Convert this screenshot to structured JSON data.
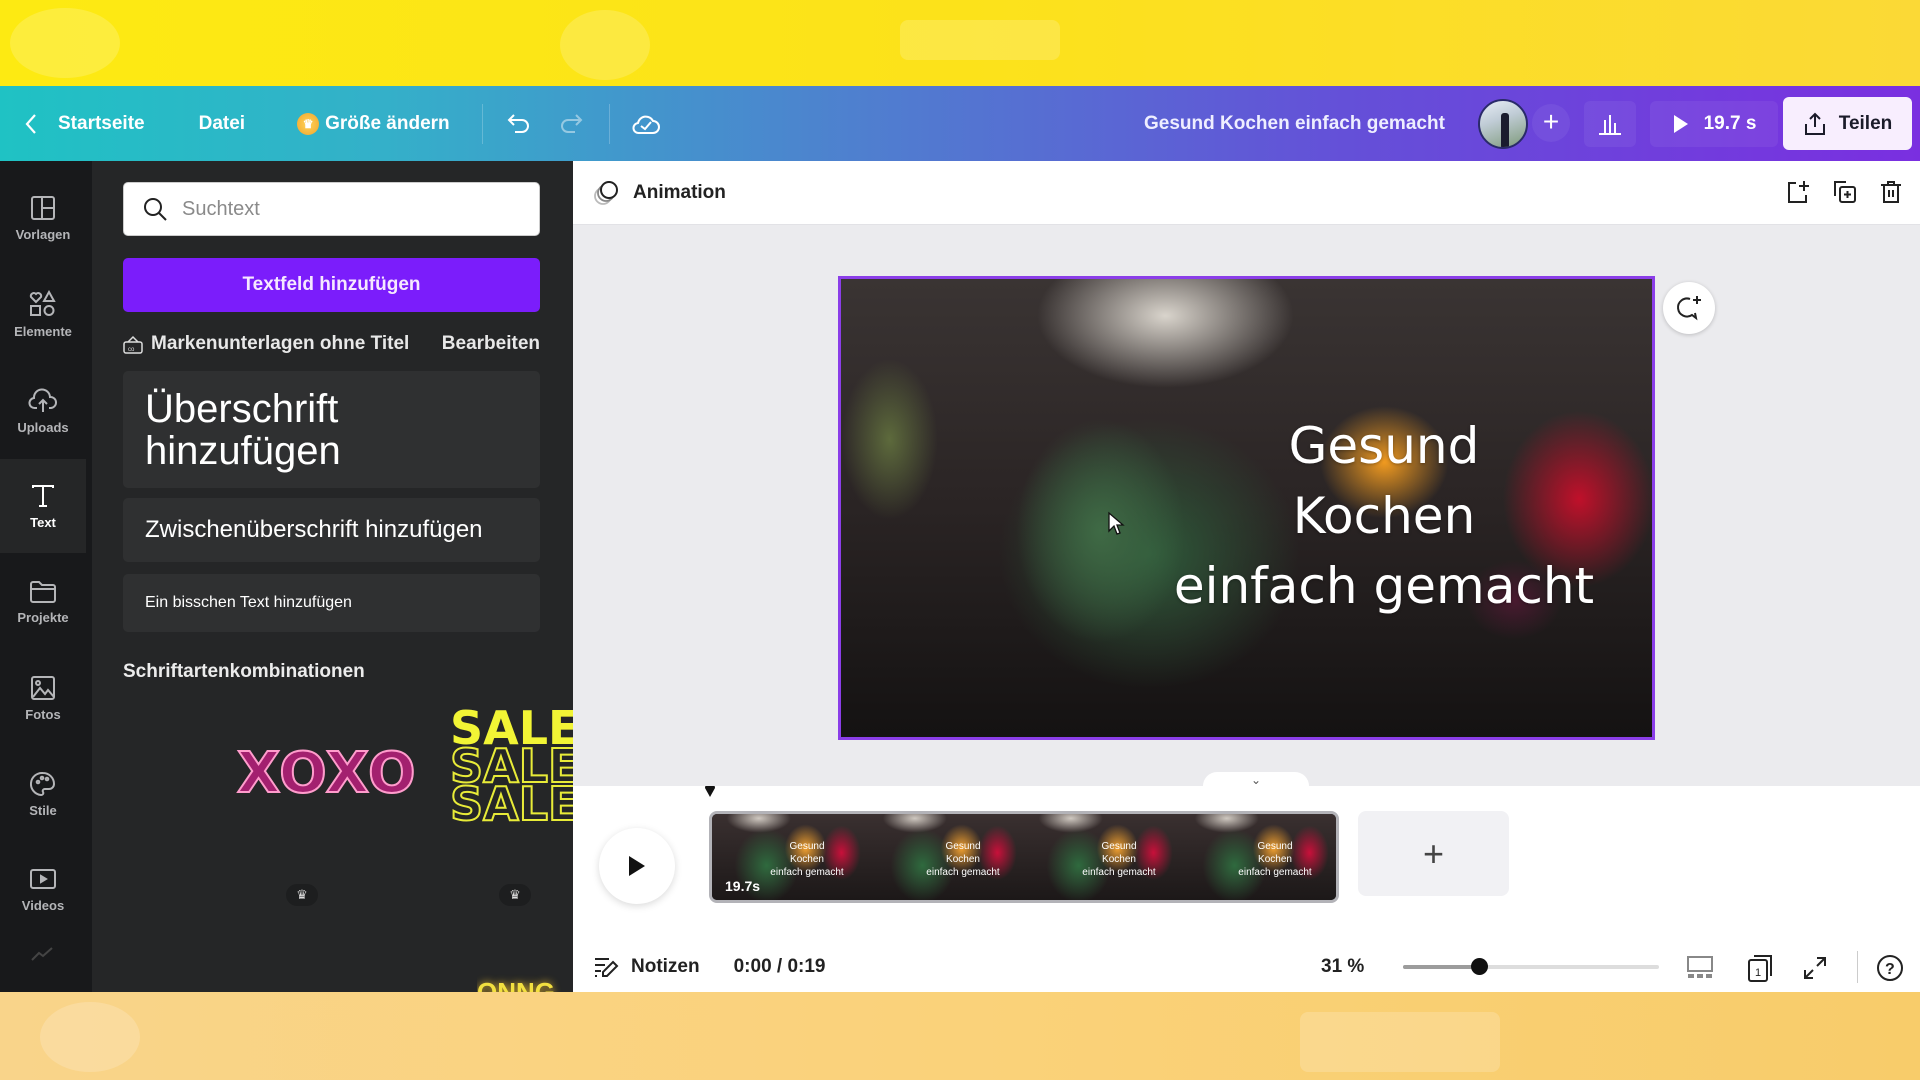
{
  "topbar": {
    "back_label": "Startseite",
    "file_label": "Datei",
    "resize_label": "Größe ändern",
    "document_title": "Gesund Kochen einfach gemacht",
    "play_duration": "19.7 s",
    "share_label": "Teilen"
  },
  "rail": {
    "items": [
      {
        "label": "Vorlagen",
        "icon": "templates-icon"
      },
      {
        "label": "Elemente",
        "icon": "elements-icon"
      },
      {
        "label": "Uploads",
        "icon": "upload-icon"
      },
      {
        "label": "Text",
        "icon": "text-icon",
        "active": true
      },
      {
        "label": "Projekte",
        "icon": "folder-icon"
      },
      {
        "label": "Fotos",
        "icon": "photo-icon"
      },
      {
        "label": "Stile",
        "icon": "palette-icon"
      },
      {
        "label": "Videos",
        "icon": "video-icon"
      }
    ]
  },
  "panel": {
    "search_placeholder": "Suchtext",
    "add_textbox_label": "Textfeld hinzufügen",
    "brand_kit_name": "Markenunterlagen ohne Titel",
    "brand_edit_label": "Bearbeiten",
    "heading_label": "Überschrift hinzufügen",
    "subheading_label": "Zwischenüberschrift hinzufügen",
    "body_label": "Ein bisschen Text hinzufügen",
    "combos_title": "Schriftartenkombinationen",
    "combos": [
      {
        "text": "XOXO",
        "premium": true
      },
      {
        "text": "SALE",
        "premium": true
      }
    ]
  },
  "workspace": {
    "animation_label": "Animation",
    "canvas_text": [
      "Gesund",
      "Kochen",
      "einfach gemacht"
    ],
    "colors": {
      "selection": "#8b3ee8",
      "primary_button": "#7b1dfb"
    }
  },
  "timeline": {
    "clip_duration": "19.7s",
    "thumb_text": [
      "Gesund",
      "Kochen",
      "einfach gemacht"
    ],
    "add_page_label": "+"
  },
  "footer": {
    "notes_label": "Notizen",
    "time": "0:00 / 0:19",
    "zoom": "31 %",
    "zoom_value": 31,
    "page_count": "1",
    "help": "?"
  }
}
